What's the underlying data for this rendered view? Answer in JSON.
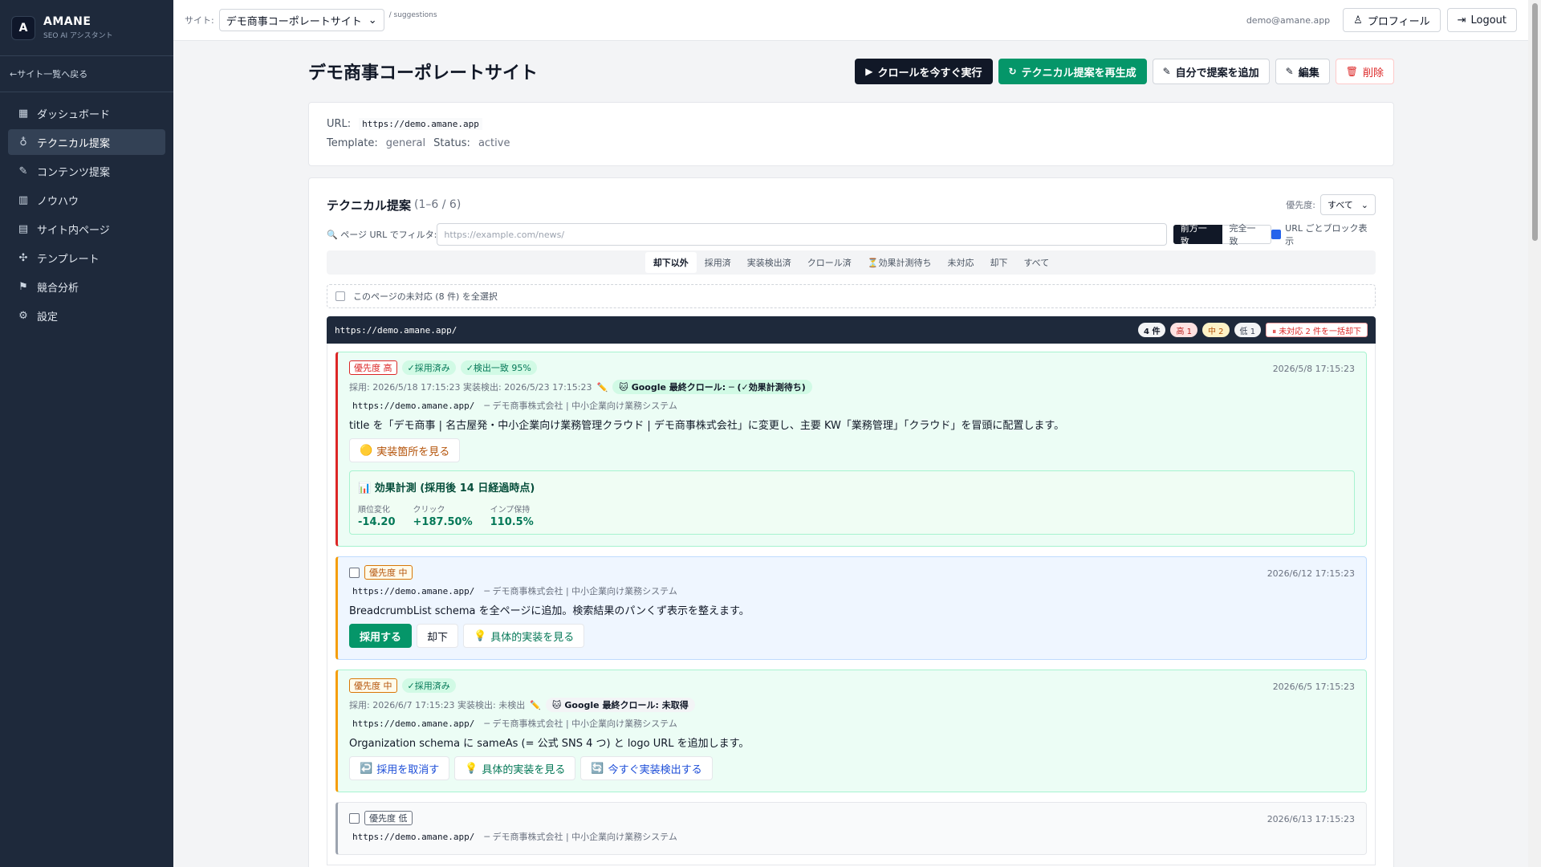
{
  "brand": {
    "logo": "A",
    "name": "AMANE",
    "sub": "SEO AI アシスタント"
  },
  "back_link": "←サイト一覧へ戻る",
  "nav": [
    {
      "label": "ダッシュボード",
      "icon": "▦"
    },
    {
      "label": "テクニカル提案",
      "icon": "♁"
    },
    {
      "label": "コンテンツ提案",
      "icon": "✎"
    },
    {
      "label": "ノウハウ",
      "icon": "▥"
    },
    {
      "label": "サイト内ページ",
      "icon": "▤"
    },
    {
      "label": "テンプレート",
      "icon": "✣"
    },
    {
      "label": "競合分析",
      "icon": "⚑"
    },
    {
      "label": "設定",
      "icon": "⚙"
    }
  ],
  "topbar": {
    "site_label": "サイト:",
    "site_value": "デモ商事コーポレートサイト",
    "crumb": "/ suggestions",
    "email": "demo@amane.app",
    "profile": "プロフィール",
    "logout": "Logout"
  },
  "page": {
    "title": "デモ商事コーポレートサイト",
    "actions": {
      "crawl": "クロールを今すぐ実行",
      "regen": "テクニカル提案を再生成",
      "add": "自分で提案を追加",
      "edit": "編集",
      "delete": "削除"
    }
  },
  "info": {
    "url_label": "URL:",
    "url_value": "https://demo.amane.app",
    "template_label": "Template:",
    "template_value": "general",
    "status_label": "Status:",
    "status_value": "active"
  },
  "list": {
    "title": "テクニカル提案",
    "count": "(1–6 / 6)",
    "priority_label": "優先度:",
    "priority_value": "すべて",
    "filter_label": "ページ URL でフィルタ:",
    "filter_placeholder": "https://example.com/news/",
    "match_prefix": "前方一致",
    "match_exact": "完全一致",
    "block_toggle": "URL ごとブロック表示",
    "tabs": [
      "却下以外",
      "採用済",
      "実装検出済",
      "クロール済",
      "⏳効果計測待ち",
      "未対応",
      "却下",
      "すべて"
    ],
    "select_all": "このページの未対応 (8 件) を全選択"
  },
  "group": {
    "url": "https://demo.amane.app/",
    "total": "4 件",
    "hi": "高 1",
    "mid": "中 2",
    "lo": "低 1",
    "bulk": "⏸ 未対応 2 件を一括却下"
  },
  "items": [
    {
      "priority": "優先度 高",
      "adopted": "✓採用済み",
      "detected": "✓検出一致 95%",
      "date": "2026/5/8 17:15:23",
      "meta": "採用: 2026/5/18 17:15:23  実装検出: 2026/5/23 17:15:23",
      "crawl": "Google 最終クロール: ─ (✓効果計測待ち)",
      "url": "https://demo.amane.app/",
      "page_title": "─ デモ商事株式会社 | 中小企業向け業務システム",
      "desc": "title を「デモ商事 | 名古屋発・中小企業向け業務管理クラウド | デモ商事株式会社」に変更し、主要 KW「業務管理」「クラウド」を冒頭に配置します。",
      "btn_view": "実装箇所を見る",
      "metric_title": "効果計測 (採用後 14 日経過時点)",
      "metrics": [
        {
          "label": "順位変化",
          "value": "-14.20"
        },
        {
          "label": "クリック",
          "value": "+187.50%"
        },
        {
          "label": "インプ保持",
          "value": "110.5%"
        }
      ]
    },
    {
      "priority": "優先度 中",
      "date": "2026/6/12 17:15:23",
      "url": "https://demo.amane.app/",
      "page_title": "─ デモ商事株式会社 | 中小企業向け業務システム",
      "desc": "BreadcrumbList schema を全ページに追加。検索結果のパンくず表示を整えます。",
      "btn_adopt": "採用する",
      "btn_reject": "却下",
      "btn_detail": "具体的実装を見る"
    },
    {
      "priority": "優先度 中",
      "adopted": "✓採用済み",
      "date": "2026/6/5 17:15:23",
      "meta": "採用: 2026/6/7 17:15:23  実装検出: 未検出",
      "crawl": "Google 最終クロール: 未取得",
      "url": "https://demo.amane.app/",
      "page_title": "─ デモ商事株式会社 | 中小企業向け業務システム",
      "desc": "Organization schema に sameAs (= 公式 SNS 4 つ) と logo URL を追加します。",
      "btn_cancel": "採用を取消す",
      "btn_detail": "具体的実装を見る",
      "btn_detect": "今すぐ実装検出する"
    },
    {
      "priority": "優先度 低",
      "date": "2026/6/13 17:15:23",
      "url": "https://demo.amane.app/",
      "page_title": "─ デモ商事株式会社 | 中小企業向け業務システム"
    }
  ]
}
